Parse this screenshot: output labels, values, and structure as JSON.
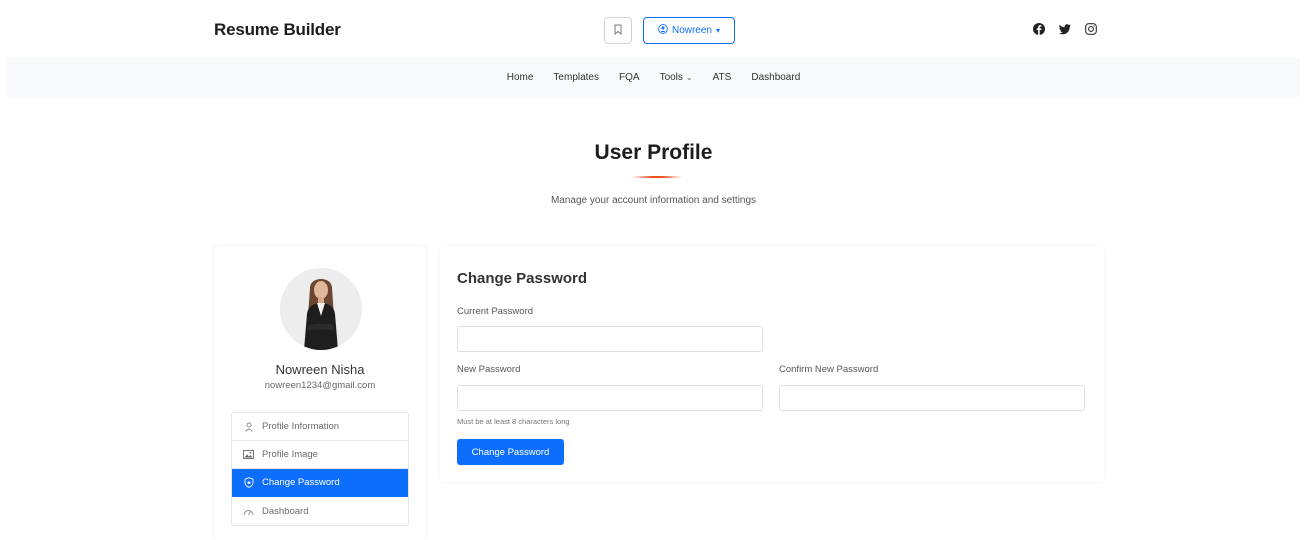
{
  "header": {
    "brand": "Resume Builder",
    "user_button_label": "Nowreen",
    "socials": [
      "facebook-icon",
      "twitter-icon",
      "instagram-icon"
    ]
  },
  "nav": {
    "items": [
      {
        "label": "Home"
      },
      {
        "label": "Templates"
      },
      {
        "label": "FQA"
      },
      {
        "label": "Tools"
      },
      {
        "label": "ATS"
      },
      {
        "label": "Dashboard"
      }
    ]
  },
  "page": {
    "title": "User Profile",
    "subtitle": "Manage your account information and settings"
  },
  "profile": {
    "name": "Nowreen Nisha",
    "email": "nowreen1234@gmail.com",
    "menu": [
      {
        "label": "Profile Information",
        "icon": "user-icon"
      },
      {
        "label": "Profile Image",
        "icon": "image-icon"
      },
      {
        "label": "Change Password",
        "icon": "shield-icon",
        "active": true
      },
      {
        "label": "Dashboard",
        "icon": "dashboard-icon"
      }
    ]
  },
  "form": {
    "title": "Change Password",
    "current_password_label": "Current Password",
    "current_password_value": "",
    "new_password_label": "New Password",
    "new_password_value": "",
    "confirm_password_label": "Confirm New Password",
    "confirm_password_value": "",
    "help_text": "Must be at least 8 characters long",
    "submit_label": "Change Password"
  },
  "colors": {
    "primary": "#0d6efd",
    "accent_underline": "#f4511e",
    "nav_bg": "#f8f9fa"
  }
}
